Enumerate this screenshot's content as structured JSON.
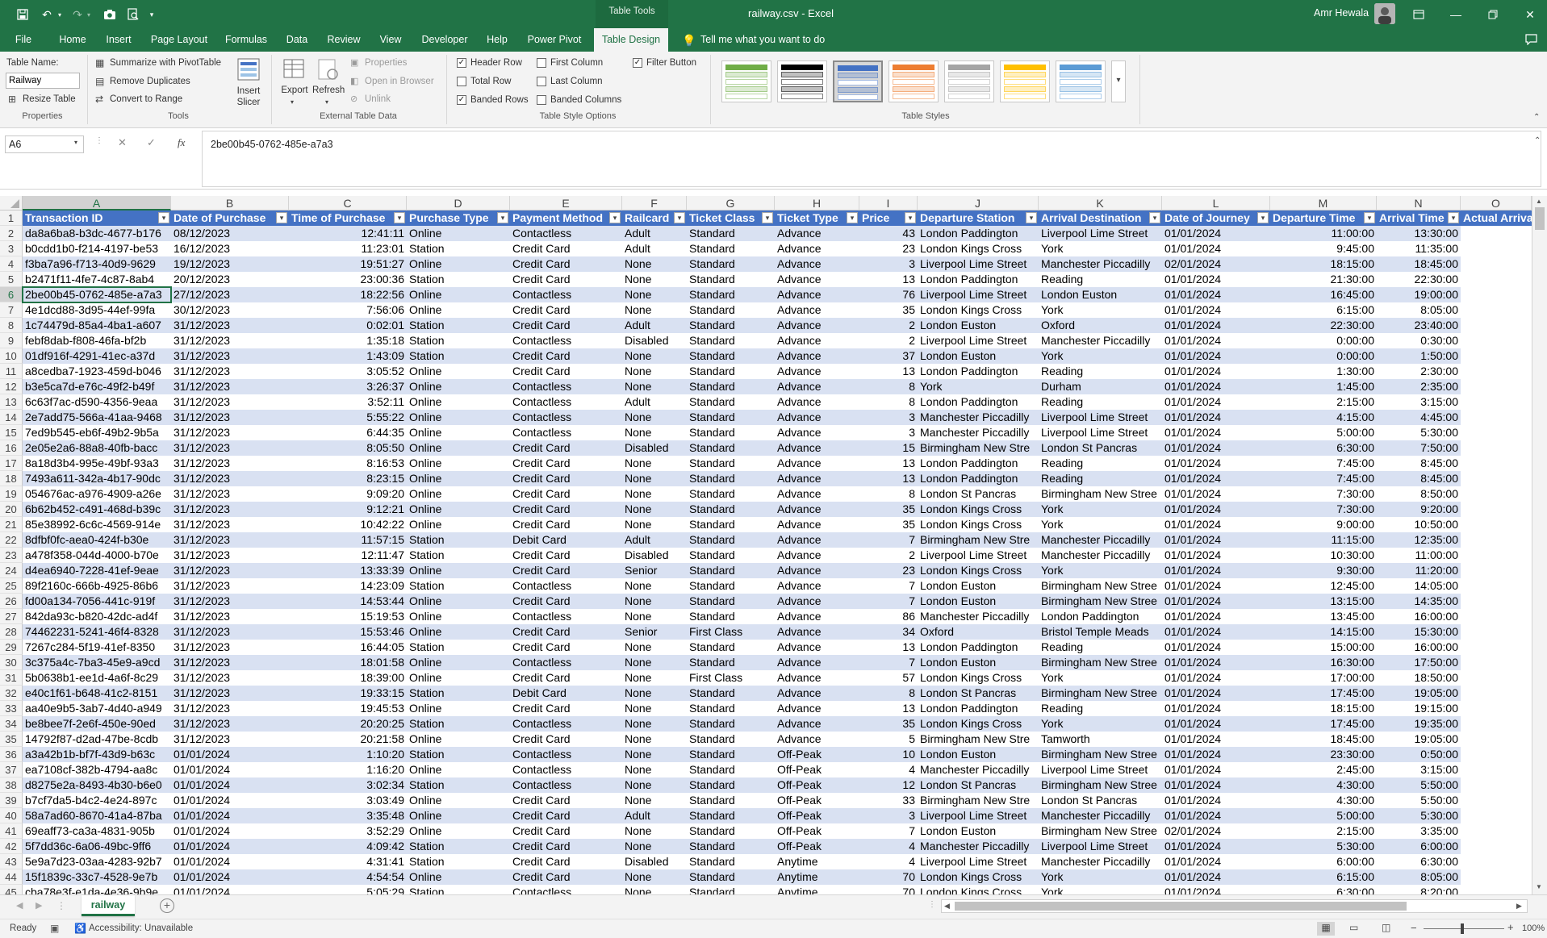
{
  "window": {
    "title": "railway.csv - Excel",
    "context_tab": "Table Tools",
    "user": "Amr Hewala"
  },
  "menu": {
    "items": [
      "File",
      "Home",
      "Insert",
      "Page Layout",
      "Formulas",
      "Data",
      "Review",
      "View",
      "Developer",
      "Help",
      "Power Pivot",
      "Table Design"
    ],
    "active": "Table Design",
    "tell_me": "Tell me what you want to do"
  },
  "ribbon": {
    "table_name_label": "Table Name:",
    "table_name_value": "Railway",
    "resize_table": "Resize Table",
    "group_properties": "Properties",
    "summarize_pivot": "Summarize with PivotTable",
    "remove_duplicates": "Remove Duplicates",
    "convert_range": "Convert to Range",
    "insert_slicer": "Insert Slicer",
    "group_tools": "Tools",
    "export": "Export",
    "refresh": "Refresh",
    "properties": "Properties",
    "open_browser": "Open in Browser",
    "unlink": "Unlink",
    "group_external": "External Table Data",
    "header_row": "Header Row",
    "total_row": "Total Row",
    "banded_rows": "Banded Rows",
    "first_column": "First Column",
    "last_column": "Last Column",
    "banded_columns": "Banded Columns",
    "filter_button": "Filter Button",
    "group_style_options": "Table Style Options",
    "group_styles": "Table Styles",
    "checks": {
      "header_row": "✓",
      "total_row": "",
      "banded_rows": "✓",
      "first_column": "",
      "last_column": "",
      "banded_columns": "",
      "filter_button": "✓"
    },
    "style_colors": [
      "#70ad47",
      "#000000",
      "#4472c4",
      "#ed7d31",
      "#a5a5a5",
      "#ffc000",
      "#5b9bd5"
    ]
  },
  "formula_bar": {
    "name_box": "A6",
    "fx": "fx",
    "value": "2be00b45-0762-485e-a7a3"
  },
  "columns": [
    "A",
    "B",
    "C",
    "D",
    "E",
    "F",
    "G",
    "H",
    "I",
    "J",
    "K",
    "L",
    "M",
    "N",
    "O"
  ],
  "headers": [
    "Transaction ID",
    "Date of Purchase",
    "Time of Purchase",
    "Purchase Type",
    "Payment Method",
    "Railcard",
    "Ticket Class",
    "Ticket Type",
    "Price",
    "Departure Station",
    "Arrival Destination",
    "Date of Journey",
    "Departure Time",
    "Arrival Time",
    "Actual Arriva"
  ],
  "rows": [
    [
      "da8a6ba8-b3dc-4677-b176",
      "08/12/2023",
      "12:41:11",
      "Online",
      "Contactless",
      "Adult",
      "Standard",
      "Advance",
      "43",
      "London Paddington",
      "Liverpool Lime Street",
      "01/01/2024",
      "11:00:00",
      "13:30:00"
    ],
    [
      "b0cdd1b0-f214-4197-be53",
      "16/12/2023",
      "11:23:01",
      "Station",
      "Credit Card",
      "Adult",
      "Standard",
      "Advance",
      "23",
      "London Kings Cross",
      "York",
      "01/01/2024",
      "9:45:00",
      "11:35:00"
    ],
    [
      "f3ba7a96-f713-40d9-9629",
      "19/12/2023",
      "19:51:27",
      "Online",
      "Credit Card",
      "None",
      "Standard",
      "Advance",
      "3",
      "Liverpool Lime Street",
      "Manchester Piccadilly",
      "02/01/2024",
      "18:15:00",
      "18:45:00"
    ],
    [
      "b2471f11-4fe7-4c87-8ab4",
      "20/12/2023",
      "23:00:36",
      "Station",
      "Credit Card",
      "None",
      "Standard",
      "Advance",
      "13",
      "London Paddington",
      "Reading",
      "01/01/2024",
      "21:30:00",
      "22:30:00"
    ],
    [
      "2be00b45-0762-485e-a7a3",
      "27/12/2023",
      "18:22:56",
      "Online",
      "Contactless",
      "None",
      "Standard",
      "Advance",
      "76",
      "Liverpool Lime Street",
      "London Euston",
      "01/01/2024",
      "16:45:00",
      "19:00:00"
    ],
    [
      "4e1dcd88-3d95-44ef-99fa",
      "30/12/2023",
      "7:56:06",
      "Online",
      "Credit Card",
      "None",
      "Standard",
      "Advance",
      "35",
      "London Kings Cross",
      "York",
      "01/01/2024",
      "6:15:00",
      "8:05:00"
    ],
    [
      "1c74479d-85a4-4ba1-a607",
      "31/12/2023",
      "0:02:01",
      "Station",
      "Credit Card",
      "Adult",
      "Standard",
      "Advance",
      "2",
      "London Euston",
      "Oxford",
      "01/01/2024",
      "22:30:00",
      "23:40:00"
    ],
    [
      "febf8dab-f808-46fa-bf2b",
      "31/12/2023",
      "1:35:18",
      "Station",
      "Contactless",
      "Disabled",
      "Standard",
      "Advance",
      "2",
      "Liverpool Lime Street",
      "Manchester Piccadilly",
      "01/01/2024",
      "0:00:00",
      "0:30:00"
    ],
    [
      "01df916f-4291-41ec-a37d",
      "31/12/2023",
      "1:43:09",
      "Station",
      "Credit Card",
      "None",
      "Standard",
      "Advance",
      "37",
      "London Euston",
      "York",
      "01/01/2024",
      "0:00:00",
      "1:50:00"
    ],
    [
      "a8cedba7-1923-459d-b046",
      "31/12/2023",
      "3:05:52",
      "Online",
      "Credit Card",
      "None",
      "Standard",
      "Advance",
      "13",
      "London Paddington",
      "Reading",
      "01/01/2024",
      "1:30:00",
      "2:30:00"
    ],
    [
      "b3e5ca7d-e76c-49f2-b49f",
      "31/12/2023",
      "3:26:37",
      "Online",
      "Contactless",
      "None",
      "Standard",
      "Advance",
      "8",
      "York",
      "Durham",
      "01/01/2024",
      "1:45:00",
      "2:35:00"
    ],
    [
      "6c63f7ac-d590-4356-9eaa",
      "31/12/2023",
      "3:52:11",
      "Online",
      "Contactless",
      "Adult",
      "Standard",
      "Advance",
      "8",
      "London Paddington",
      "Reading",
      "01/01/2024",
      "2:15:00",
      "3:15:00"
    ],
    [
      "2e7add75-566a-41aa-9468",
      "31/12/2023",
      "5:55:22",
      "Online",
      "Contactless",
      "None",
      "Standard",
      "Advance",
      "3",
      "Manchester Piccadilly",
      "Liverpool Lime Street",
      "01/01/2024",
      "4:15:00",
      "4:45:00"
    ],
    [
      "7ed9b545-eb6f-49b2-9b5a",
      "31/12/2023",
      "6:44:35",
      "Online",
      "Contactless",
      "None",
      "Standard",
      "Advance",
      "3",
      "Manchester Piccadilly",
      "Liverpool Lime Street",
      "01/01/2024",
      "5:00:00",
      "5:30:00"
    ],
    [
      "2e05e2a6-88a8-40fb-bacc",
      "31/12/2023",
      "8:05:50",
      "Online",
      "Credit Card",
      "Disabled",
      "Standard",
      "Advance",
      "15",
      "Birmingham New Stre",
      "London St Pancras",
      "01/01/2024",
      "6:30:00",
      "7:50:00"
    ],
    [
      "8a18d3b4-995e-49bf-93a3",
      "31/12/2023",
      "8:16:53",
      "Online",
      "Credit Card",
      "None",
      "Standard",
      "Advance",
      "13",
      "London Paddington",
      "Reading",
      "01/01/2024",
      "7:45:00",
      "8:45:00"
    ],
    [
      "7493a611-342a-4b17-90dc",
      "31/12/2023",
      "8:23:15",
      "Online",
      "Credit Card",
      "None",
      "Standard",
      "Advance",
      "13",
      "London Paddington",
      "Reading",
      "01/01/2024",
      "7:45:00",
      "8:45:00"
    ],
    [
      "054676ac-a976-4909-a26e",
      "31/12/2023",
      "9:09:20",
      "Online",
      "Credit Card",
      "None",
      "Standard",
      "Advance",
      "8",
      "London St Pancras",
      "Birmingham New Stree",
      "01/01/2024",
      "7:30:00",
      "8:50:00"
    ],
    [
      "6b62b452-c491-468d-b39c",
      "31/12/2023",
      "9:12:21",
      "Online",
      "Credit Card",
      "None",
      "Standard",
      "Advance",
      "35",
      "London Kings Cross",
      "York",
      "01/01/2024",
      "7:30:00",
      "9:20:00"
    ],
    [
      "85e38992-6c6c-4569-914e",
      "31/12/2023",
      "10:42:22",
      "Online",
      "Credit Card",
      "None",
      "Standard",
      "Advance",
      "35",
      "London Kings Cross",
      "York",
      "01/01/2024",
      "9:00:00",
      "10:50:00"
    ],
    [
      "8dfbf0fc-aea0-424f-b30e",
      "31/12/2023",
      "11:57:15",
      "Station",
      "Debit Card",
      "Adult",
      "Standard",
      "Advance",
      "7",
      "Birmingham New Stre",
      "Manchester Piccadilly",
      "01/01/2024",
      "11:15:00",
      "12:35:00"
    ],
    [
      "a478f358-044d-4000-b70e",
      "31/12/2023",
      "12:11:47",
      "Station",
      "Credit Card",
      "Disabled",
      "Standard",
      "Advance",
      "2",
      "Liverpool Lime Street",
      "Manchester Piccadilly",
      "01/01/2024",
      "10:30:00",
      "11:00:00"
    ],
    [
      "d4ea6940-7228-41ef-9eae",
      "31/12/2023",
      "13:33:39",
      "Online",
      "Credit Card",
      "Senior",
      "Standard",
      "Advance",
      "23",
      "London Kings Cross",
      "York",
      "01/01/2024",
      "9:30:00",
      "11:20:00"
    ],
    [
      "89f2160c-666b-4925-86b6",
      "31/12/2023",
      "14:23:09",
      "Station",
      "Contactless",
      "None",
      "Standard",
      "Advance",
      "7",
      "London Euston",
      "Birmingham New Stree",
      "01/01/2024",
      "12:45:00",
      "14:05:00"
    ],
    [
      "fd00a134-7056-441c-919f",
      "31/12/2023",
      "14:53:44",
      "Online",
      "Credit Card",
      "None",
      "Standard",
      "Advance",
      "7",
      "London Euston",
      "Birmingham New Stree",
      "01/01/2024",
      "13:15:00",
      "14:35:00"
    ],
    [
      "842da93c-b820-42dc-ad4f",
      "31/12/2023",
      "15:19:53",
      "Online",
      "Contactless",
      "None",
      "Standard",
      "Advance",
      "86",
      "Manchester Piccadilly",
      "London Paddington",
      "01/01/2024",
      "13:45:00",
      "16:00:00"
    ],
    [
      "74462231-5241-46f4-8328",
      "31/12/2023",
      "15:53:46",
      "Online",
      "Credit Card",
      "Senior",
      "First Class",
      "Advance",
      "34",
      "Oxford",
      "Bristol Temple Meads",
      "01/01/2024",
      "14:15:00",
      "15:30:00"
    ],
    [
      "7267c284-5f19-41ef-8350",
      "31/12/2023",
      "16:44:05",
      "Station",
      "Credit Card",
      "None",
      "Standard",
      "Advance",
      "13",
      "London Paddington",
      "Reading",
      "01/01/2024",
      "15:00:00",
      "16:00:00"
    ],
    [
      "3c375a4c-7ba3-45e9-a9cd",
      "31/12/2023",
      "18:01:58",
      "Online",
      "Contactless",
      "None",
      "Standard",
      "Advance",
      "7",
      "London Euston",
      "Birmingham New Stree",
      "01/01/2024",
      "16:30:00",
      "17:50:00"
    ],
    [
      "5b0638b1-ee1d-4a6f-8c29",
      "31/12/2023",
      "18:39:00",
      "Online",
      "Credit Card",
      "None",
      "First Class",
      "Advance",
      "57",
      "London Kings Cross",
      "York",
      "01/01/2024",
      "17:00:00",
      "18:50:00"
    ],
    [
      "e40c1f61-b648-41c2-8151",
      "31/12/2023",
      "19:33:15",
      "Station",
      "Debit Card",
      "None",
      "Standard",
      "Advance",
      "8",
      "London St Pancras",
      "Birmingham New Stree",
      "01/01/2024",
      "17:45:00",
      "19:05:00"
    ],
    [
      "aa40e9b5-3ab7-4d40-a949",
      "31/12/2023",
      "19:45:53",
      "Online",
      "Credit Card",
      "None",
      "Standard",
      "Advance",
      "13",
      "London Paddington",
      "Reading",
      "01/01/2024",
      "18:15:00",
      "19:15:00"
    ],
    [
      "be8bee7f-2e6f-450e-90ed",
      "31/12/2023",
      "20:20:25",
      "Station",
      "Contactless",
      "None",
      "Standard",
      "Advance",
      "35",
      "London Kings Cross",
      "York",
      "01/01/2024",
      "17:45:00",
      "19:35:00"
    ],
    [
      "14792f87-d2ad-47be-8cdb",
      "31/12/2023",
      "20:21:58",
      "Online",
      "Credit Card",
      "None",
      "Standard",
      "Advance",
      "5",
      "Birmingham New Stre",
      "Tamworth",
      "01/01/2024",
      "18:45:00",
      "19:05:00"
    ],
    [
      "a3a42b1b-bf7f-43d9-b63c",
      "01/01/2024",
      "1:10:20",
      "Station",
      "Contactless",
      "None",
      "Standard",
      "Off-Peak",
      "10",
      "London Euston",
      "Birmingham New Stree",
      "01/01/2024",
      "23:30:00",
      "0:50:00"
    ],
    [
      "ea7108cf-382b-4794-aa8c",
      "01/01/2024",
      "1:16:20",
      "Online",
      "Contactless",
      "None",
      "Standard",
      "Off-Peak",
      "4",
      "Manchester Piccadilly",
      "Liverpool Lime Street",
      "01/01/2024",
      "2:45:00",
      "3:15:00"
    ],
    [
      "d8275e2a-8493-4b30-b6e0",
      "01/01/2024",
      "3:02:34",
      "Station",
      "Contactless",
      "None",
      "Standard",
      "Off-Peak",
      "12",
      "London St Pancras",
      "Birmingham New Stree",
      "01/01/2024",
      "4:30:00",
      "5:50:00"
    ],
    [
      "b7cf7da5-b4c2-4e24-897c",
      "01/01/2024",
      "3:03:49",
      "Online",
      "Credit Card",
      "None",
      "Standard",
      "Off-Peak",
      "33",
      "Birmingham New Stre",
      "London St Pancras",
      "01/01/2024",
      "4:30:00",
      "5:50:00"
    ],
    [
      "58a7ad60-8670-41a4-87ba",
      "01/01/2024",
      "3:35:48",
      "Online",
      "Credit Card",
      "Adult",
      "Standard",
      "Off-Peak",
      "3",
      "Liverpool Lime Street",
      "Manchester Piccadilly",
      "01/01/2024",
      "5:00:00",
      "5:30:00"
    ],
    [
      "69eaff73-ca3a-4831-905b",
      "01/01/2024",
      "3:52:29",
      "Online",
      "Credit Card",
      "None",
      "Standard",
      "Off-Peak",
      "7",
      "London Euston",
      "Birmingham New Stree",
      "02/01/2024",
      "2:15:00",
      "3:35:00"
    ],
    [
      "5f7dd36c-6a06-49bc-9ff6",
      "01/01/2024",
      "4:09:42",
      "Station",
      "Credit Card",
      "None",
      "Standard",
      "Off-Peak",
      "4",
      "Manchester Piccadilly",
      "Liverpool Lime Street",
      "01/01/2024",
      "5:30:00",
      "6:00:00"
    ],
    [
      "5e9a7d23-03aa-4283-92b7",
      "01/01/2024",
      "4:31:41",
      "Station",
      "Credit Card",
      "Disabled",
      "Standard",
      "Anytime",
      "4",
      "Liverpool Lime Street",
      "Manchester Piccadilly",
      "01/01/2024",
      "6:00:00",
      "6:30:00"
    ],
    [
      "15f1839c-33c7-4528-9e7b",
      "01/01/2024",
      "4:54:54",
      "Online",
      "Credit Card",
      "None",
      "Standard",
      "Anytime",
      "70",
      "London Kings Cross",
      "York",
      "01/01/2024",
      "6:15:00",
      "8:05:00"
    ],
    [
      "cba78e3f-e1da-4e36-9b9e",
      "01/01/2024",
      "5:05:29",
      "Station",
      "Contactless",
      "None",
      "Standard",
      "Anytime",
      "70",
      "London Kings Cross",
      "York",
      "01/01/2024",
      "6:30:00",
      "8:20:00"
    ]
  ],
  "sheet": {
    "tab": "railway"
  },
  "status": {
    "ready": "Ready",
    "accessibility": "Accessibility: Unavailable",
    "zoom": "100%"
  }
}
